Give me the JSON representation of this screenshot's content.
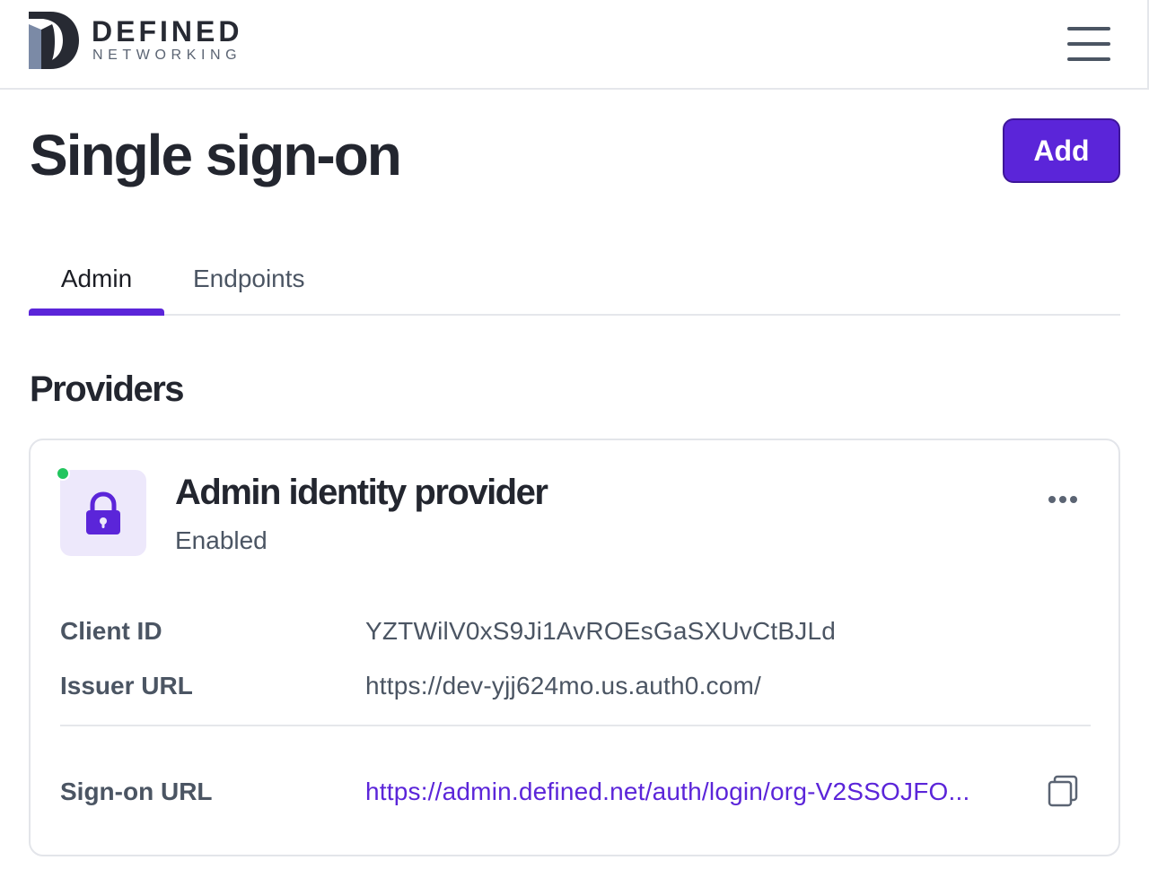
{
  "header": {
    "brand_name": "DEFINED",
    "brand_sub": "NETWORKING",
    "menu_icon": "hamburger-menu-icon"
  },
  "page": {
    "title": "Single sign-on",
    "add_label": "Add"
  },
  "tabs": [
    {
      "label": "Admin",
      "active": true
    },
    {
      "label": "Endpoints",
      "active": false
    }
  ],
  "section": {
    "title": "Providers"
  },
  "provider": {
    "name": "Admin identity provider",
    "status": "Enabled",
    "status_color": "#22c55e",
    "icon": "lock-icon",
    "details": {
      "client_id_label": "Client ID",
      "client_id_value": "YZTWilV0xS9Ji1AvROEsGaSXUvCtBJLd",
      "issuer_url_label": "Issuer URL",
      "issuer_url_value": "https://dev-yjj624mo.us.auth0.com/",
      "signon_url_label": "Sign-on URL",
      "signon_url_value": "https://admin.defined.net/auth/login/org-V2SSOJFO..."
    }
  },
  "colors": {
    "accent": "#5b25d9",
    "text_dark": "#23262f",
    "text_muted": "#4b5563"
  }
}
